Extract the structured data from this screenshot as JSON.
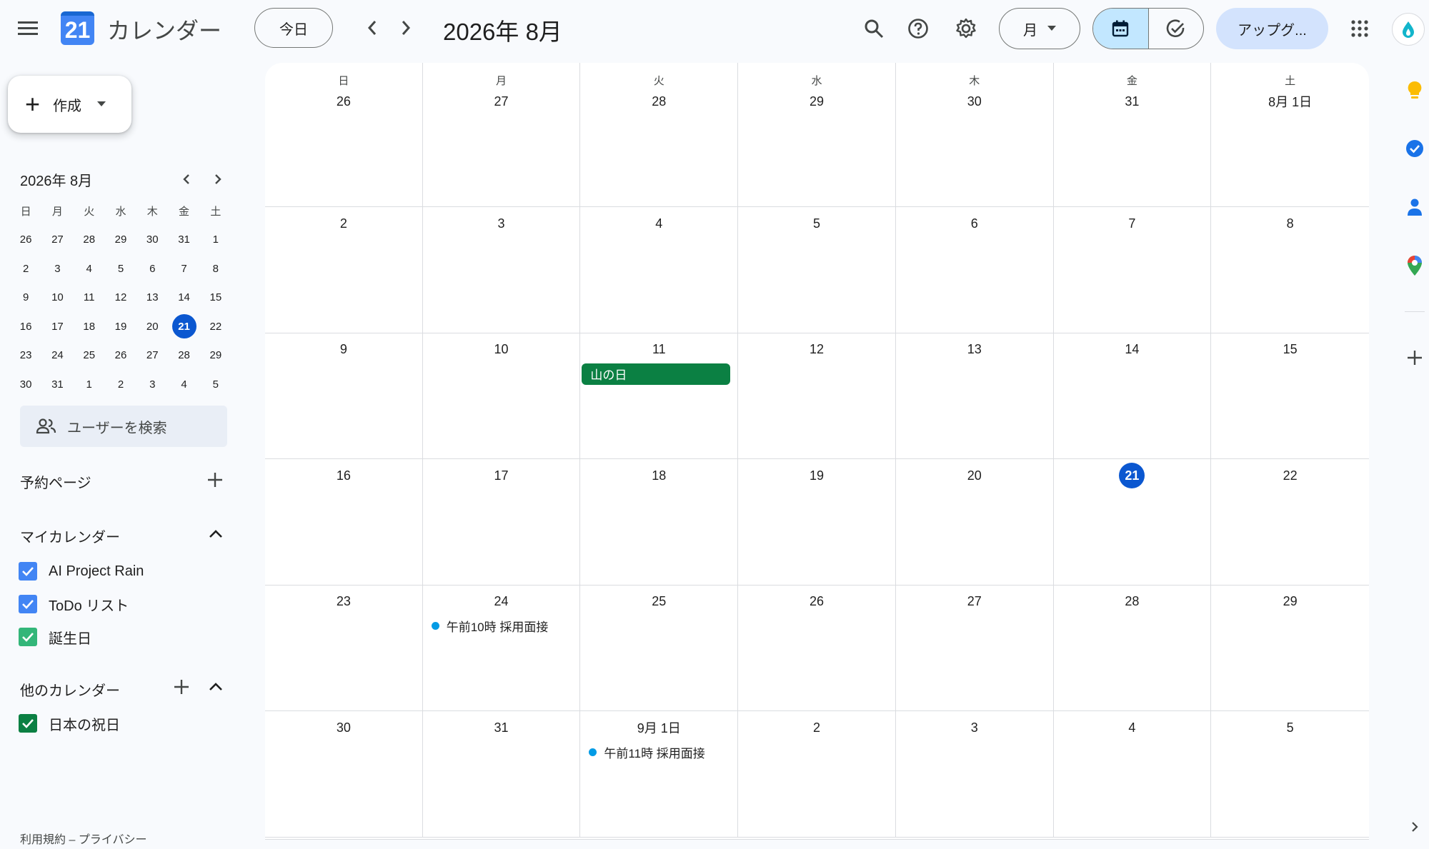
{
  "header": {
    "app_title": "カレンダー",
    "logo_day": "21",
    "today_label": "今日",
    "current_period": "2026年 8月",
    "view_label": "月",
    "upgrade_label": "アップグ..."
  },
  "sidebar": {
    "create_label": "作成",
    "mini_calendar": {
      "title": "2026年 8月",
      "weekdays": [
        "日",
        "月",
        "火",
        "水",
        "木",
        "金",
        "土"
      ],
      "weeks": [
        [
          "26",
          "27",
          "28",
          "29",
          "30",
          "31",
          "1"
        ],
        [
          "2",
          "3",
          "4",
          "5",
          "6",
          "7",
          "8"
        ],
        [
          "9",
          "10",
          "11",
          "12",
          "13",
          "14",
          "15"
        ],
        [
          "16",
          "17",
          "18",
          "19",
          "20",
          "21",
          "22"
        ],
        [
          "23",
          "24",
          "25",
          "26",
          "27",
          "28",
          "29"
        ],
        [
          "30",
          "31",
          "1",
          "2",
          "3",
          "4",
          "5"
        ]
      ],
      "today": "21"
    },
    "search_people_placeholder": "ユーザーを検索",
    "booking_pages_label": "予約ページ",
    "my_calendars_label": "マイカレンダー",
    "my_calendars": [
      {
        "name": "AI Project Rain",
        "color": "#4285f4"
      },
      {
        "name": "ToDo リスト",
        "color": "#4285f4"
      },
      {
        "name": "誕生日",
        "color": "#33b679"
      }
    ],
    "other_calendars_label": "他のカレンダー",
    "other_calendars": [
      {
        "name": "日本の祝日",
        "color": "#0b8043"
      }
    ],
    "footer": "利用規約 – プライバシー"
  },
  "calendar": {
    "weekdays": [
      "日",
      "月",
      "火",
      "水",
      "木",
      "金",
      "土"
    ],
    "weeks": [
      [
        "26",
        "27",
        "28",
        "29",
        "30",
        "31",
        "8月 1日"
      ],
      [
        "2",
        "3",
        "4",
        "5",
        "6",
        "7",
        "8"
      ],
      [
        "9",
        "10",
        "11",
        "12",
        "13",
        "14",
        "15"
      ],
      [
        "16",
        "17",
        "18",
        "19",
        "20",
        "21",
        "22"
      ],
      [
        "23",
        "24",
        "25",
        "26",
        "27",
        "28",
        "29"
      ],
      [
        "30",
        "31",
        "9月 1日",
        "2",
        "3",
        "4",
        "5"
      ]
    ],
    "today": "21",
    "events": {
      "holiday": "山の日",
      "interview_1": "午前10時 採用面接",
      "interview_2": "午前11時 採用面接"
    },
    "colors": {
      "accent": "#0b57d0",
      "holiday": "#0b8043",
      "event_dot": "#039be5"
    }
  }
}
